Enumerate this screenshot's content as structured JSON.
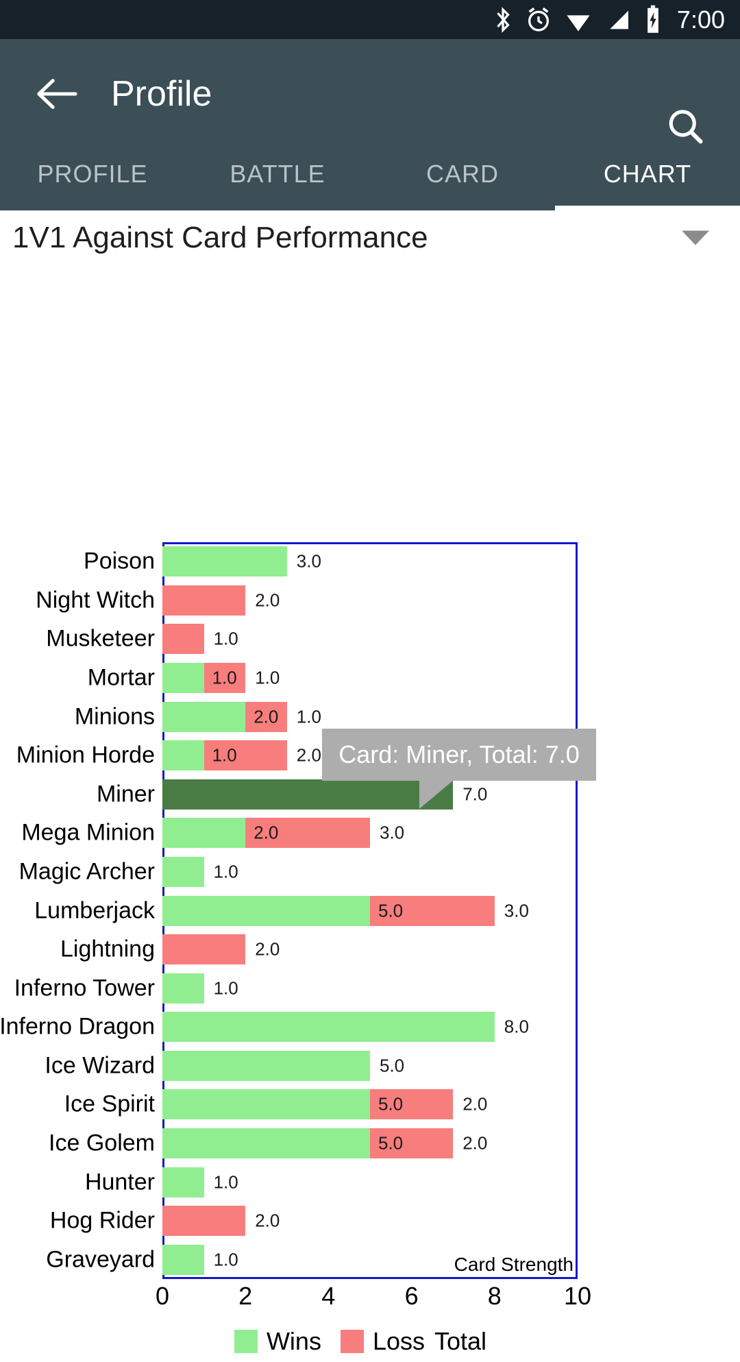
{
  "statusbar": {
    "time": "7:00",
    "icons": [
      "bluetooth-icon",
      "alarm-icon",
      "wifi-icon",
      "signal-icon",
      "battery-charging-icon"
    ]
  },
  "appbar": {
    "back_icon": "back-arrow-icon",
    "title": "Profile",
    "search_icon": "search-icon"
  },
  "tabs": [
    {
      "label": "PROFILE",
      "active": false
    },
    {
      "label": "BATTLE",
      "active": false
    },
    {
      "label": "CARD",
      "active": false
    },
    {
      "label": "CHART",
      "active": true
    }
  ],
  "title_row": {
    "title": "1V1 Against Card Performance",
    "dropdown_icon": "chevron-down-icon"
  },
  "tooltip": {
    "text": "Card: Miner, Total: 7.0"
  },
  "colors": {
    "appbar": "#3c4e56",
    "statusbar": "#16212a",
    "wins": "#90ee90",
    "loss": "#f87d7d",
    "highlight": "#4a7c46",
    "plot_border": "#1718c9",
    "tooltip_bg": "#adadad"
  },
  "chart_data": {
    "type": "bar",
    "orientation": "horizontal",
    "stacked": true,
    "title": "1V1 Against Card Performance",
    "xlabel": "Card Strength",
    "ylabel": "",
    "xlim": [
      0,
      10
    ],
    "xticks": [
      0,
      2,
      4,
      6,
      8,
      10
    ],
    "grid": false,
    "legend": {
      "position": "bottom",
      "entries": [
        {
          "name": "Wins",
          "color": "#90ee90"
        },
        {
          "name": "Loss",
          "color": "#f87d7d"
        },
        {
          "name": "Total",
          "color": ""
        }
      ]
    },
    "categories": [
      "Poison",
      "Night Witch",
      "Musketeer",
      "Mortar",
      "Minions",
      "Minion Horde",
      "Miner",
      "Mega Minion",
      "Magic Archer",
      "Lumberjack",
      "Lightning",
      "Inferno Tower",
      "Inferno Dragon",
      "Ice Wizard",
      "Ice Spirit",
      "Ice Golem",
      "Hunter",
      "Hog Rider",
      "Graveyard"
    ],
    "series": [
      {
        "name": "Wins",
        "color": "#90ee90",
        "values": [
          3,
          0,
          0,
          1,
          2,
          1,
          7,
          2,
          1,
          5,
          0,
          1,
          8,
          5,
          5,
          5,
          1,
          0,
          1
        ]
      },
      {
        "name": "Loss",
        "color": "#f87d7d",
        "values": [
          0,
          2,
          1,
          1,
          1,
          2,
          0,
          3,
          0,
          3,
          2,
          0,
          0,
          0,
          2,
          2,
          0,
          2,
          0
        ]
      }
    ],
    "rows": [
      {
        "card": "Poison",
        "wins": 3,
        "loss": 0,
        "highlight": false,
        "inner_label": "",
        "outer_label": "3.0"
      },
      {
        "card": "Night Witch",
        "wins": 0,
        "loss": 2,
        "highlight": false,
        "inner_label": "",
        "outer_label": "2.0"
      },
      {
        "card": "Musketeer",
        "wins": 0,
        "loss": 1,
        "highlight": false,
        "inner_label": "",
        "outer_label": "1.0"
      },
      {
        "card": "Mortar",
        "wins": 1,
        "loss": 1,
        "highlight": false,
        "inner_label": "1.0",
        "outer_label": "1.0"
      },
      {
        "card": "Minions",
        "wins": 2,
        "loss": 1,
        "highlight": false,
        "inner_label": "2.0",
        "outer_label": "1.0"
      },
      {
        "card": "Minion Horde",
        "wins": 1,
        "loss": 2,
        "highlight": false,
        "inner_label": "1.0",
        "outer_label": "2.0"
      },
      {
        "card": "Miner",
        "wins": 7,
        "loss": 0,
        "highlight": true,
        "inner_label": "",
        "outer_label": "7.0"
      },
      {
        "card": "Mega Minion",
        "wins": 2,
        "loss": 3,
        "highlight": false,
        "inner_label": "2.0",
        "outer_label": "3.0"
      },
      {
        "card": "Magic Archer",
        "wins": 1,
        "loss": 0,
        "highlight": false,
        "inner_label": "",
        "outer_label": "1.0"
      },
      {
        "card": "Lumberjack",
        "wins": 5,
        "loss": 3,
        "highlight": false,
        "inner_label": "5.0",
        "outer_label": "3.0"
      },
      {
        "card": "Lightning",
        "wins": 0,
        "loss": 2,
        "highlight": false,
        "inner_label": "",
        "outer_label": "2.0"
      },
      {
        "card": "Inferno Tower",
        "wins": 1,
        "loss": 0,
        "highlight": false,
        "inner_label": "",
        "outer_label": "1.0"
      },
      {
        "card": "Inferno Dragon",
        "wins": 8,
        "loss": 0,
        "highlight": false,
        "inner_label": "",
        "outer_label": "8.0"
      },
      {
        "card": "Ice Wizard",
        "wins": 5,
        "loss": 0,
        "highlight": false,
        "inner_label": "",
        "outer_label": "5.0"
      },
      {
        "card": "Ice Spirit",
        "wins": 5,
        "loss": 2,
        "highlight": false,
        "inner_label": "5.0",
        "outer_label": "2.0"
      },
      {
        "card": "Ice Golem",
        "wins": 5,
        "loss": 2,
        "highlight": false,
        "inner_label": "5.0",
        "outer_label": "2.0"
      },
      {
        "card": "Hunter",
        "wins": 1,
        "loss": 0,
        "highlight": false,
        "inner_label": "",
        "outer_label": "1.0"
      },
      {
        "card": "Hog Rider",
        "wins": 0,
        "loss": 2,
        "highlight": false,
        "inner_label": "",
        "outer_label": "2.0"
      },
      {
        "card": "Graveyard",
        "wins": 1,
        "loss": 0,
        "highlight": false,
        "inner_label": "",
        "outer_label": "1.0"
      }
    ]
  }
}
